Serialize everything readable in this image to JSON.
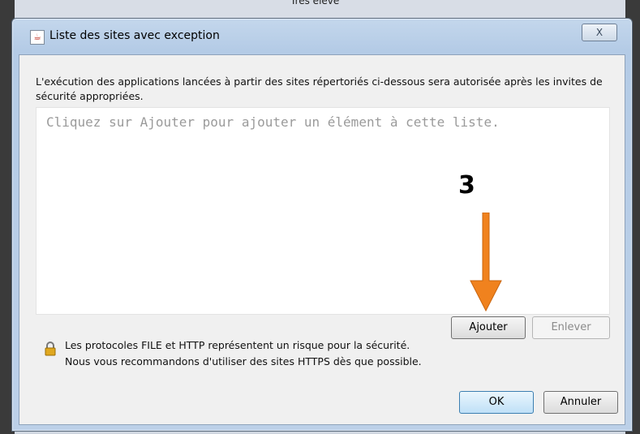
{
  "background": {
    "top_text": "Très élevé"
  },
  "dialog": {
    "title": "Liste des sites avec exception",
    "close_label": "X",
    "description": "L'exécution des applications lancées à partir des sites répertoriés ci-dessous sera autorisée après les invites de sécurité appropriées.",
    "list_placeholder": "Cliquez sur Ajouter pour ajouter un élément à cette liste.",
    "buttons": {
      "add": "Ajouter",
      "remove": "Enlever",
      "ok": "OK",
      "cancel": "Annuler"
    },
    "warning_line1": "Les protocoles FILE et HTTP représentent un risque pour la sécurité.",
    "warning_line2": "Nous vous recommandons d'utiliser des sites HTTPS dès que possible."
  },
  "annotation": {
    "step": "3",
    "arrow_color": "#f0821e"
  },
  "icons": [
    "java-icon",
    "close-icon",
    "lock-icon",
    "arrow-down-icon"
  ]
}
